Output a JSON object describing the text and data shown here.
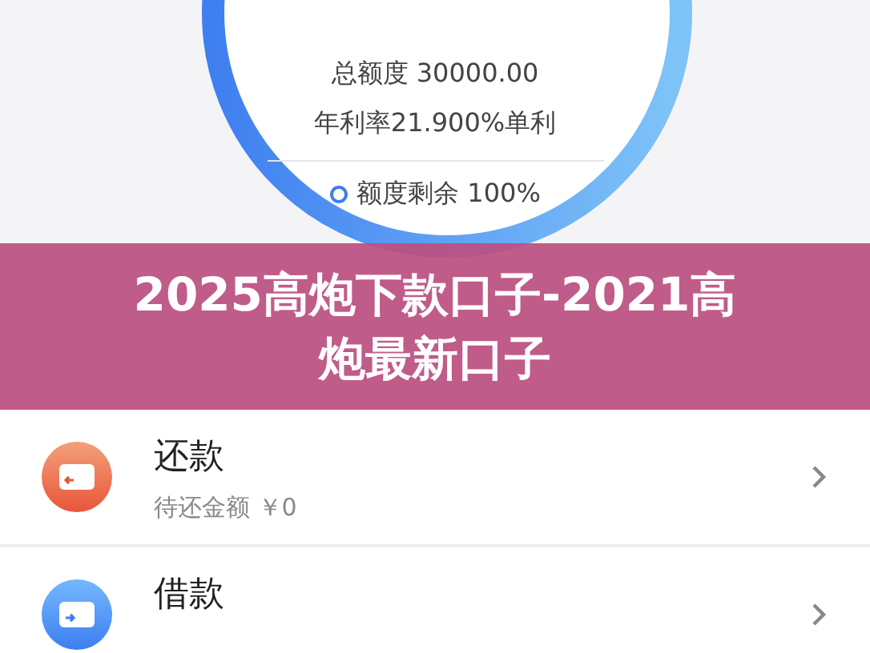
{
  "credit": {
    "total": "总额度 30000.00",
    "rate": "年利率21.900%单利",
    "remaining": "额度剩余 100%"
  },
  "banner": {
    "title": "2025高炮下款口子-2021高炮最新口子"
  },
  "items": [
    {
      "kind": "repay",
      "title": "还款",
      "subtitle": "待还金额 ￥0"
    },
    {
      "kind": "borrow",
      "title": "借款"
    }
  ]
}
